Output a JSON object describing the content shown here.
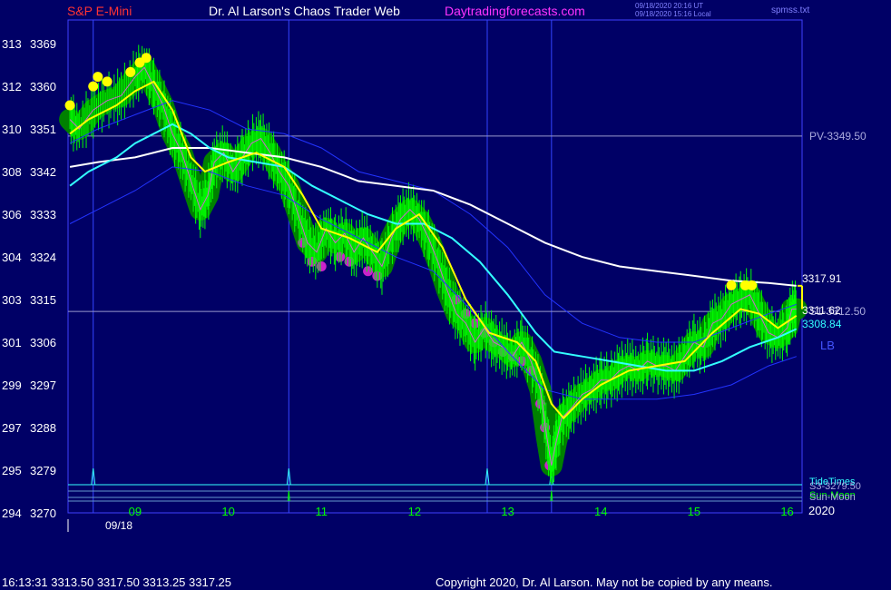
{
  "header": {
    "symbol": "S&P E-Mini",
    "site_title": "Dr. Al Larson's Chaos Trader Web",
    "site_link": "Daytradingforecasts.com",
    "stamp_utc": "09/18/2020 20:16 UT",
    "stamp_local": "09/18/2020 15:16 Local",
    "stamp_file": "spmss.txt"
  },
  "footer": {
    "last_bar": "16:13:31  3313.50 3317.50 3313.25 3317.25",
    "copyright": "Copyright 2020, Dr. Al Larson. May not be copied by any means."
  },
  "colors": {
    "background": "#000066",
    "frame": "#4040ff",
    "price": "#00ff00",
    "band": "#008000",
    "ema_fast": "#ffff00",
    "ema_mid": "#33ffff",
    "ema_slow": "#ffffff",
    "envelope": "#2233ff",
    "level_line": "#9999cc",
    "timing_line": "#3344ff",
    "tide_line": "#33ffff",
    "axis_text": "#ffffff",
    "hour_text": "#00ff00",
    "title_red": "#ff3333",
    "link_magenta": "#ff33ff"
  },
  "chart_data": {
    "type": "line",
    "title": "S&P E-Mini",
    "ylim": [
      3270,
      3374
    ],
    "xlim": [
      8.28,
      16.16
    ],
    "y_ticks": [
      {
        "sun": "313",
        "price": "3369"
      },
      {
        "sun": "312",
        "price": "3360"
      },
      {
        "sun": "310",
        "price": "3351"
      },
      {
        "sun": "308",
        "price": "3342"
      },
      {
        "sun": "306",
        "price": "3333"
      },
      {
        "sun": "304",
        "price": "3324"
      },
      {
        "sun": "303",
        "price": "3315"
      },
      {
        "sun": "301",
        "price": "3306"
      },
      {
        "sun": "299",
        "price": "3297"
      },
      {
        "sun": "297",
        "price": "3288"
      },
      {
        "sun": "295",
        "price": "3279"
      },
      {
        "sun": "294",
        "price": "3270"
      }
    ],
    "x_ticks": [
      "09",
      "10",
      "11",
      "12",
      "13",
      "14",
      "15",
      "16"
    ],
    "date_label": "09/18",
    "year_label": "2020",
    "levels": [
      {
        "label": "PV-3349.50",
        "value": 3349.5
      },
      {
        "label": "S1-3312.50",
        "value": 3312.5
      }
    ],
    "bottom_labels": [
      "TideTimes",
      "S3-3279.50",
      "Sun-Moon",
      "Sun-Moon"
    ],
    "last_values": [
      {
        "label": "3317.91",
        "value": 3317.91,
        "series": "ema_slow"
      },
      {
        "label": "3311.62",
        "value": 3311.62,
        "series": "ema_fast"
      },
      {
        "label": "3308.84",
        "value": 3308.84,
        "series": "ema_mid"
      }
    ],
    "side_labels": [
      "LB"
    ],
    "vertical_time_lines": [
      8.55,
      10.65,
      12.78,
      13.47
    ],
    "tide_spikes": [
      8.55,
      10.65,
      12.78,
      13.47
    ],
    "moon_spikes": [
      10.65,
      13.47
    ],
    "series": [
      {
        "name": "price",
        "points": [
          [
            8.3,
            3353
          ],
          [
            8.4,
            3351
          ],
          [
            8.55,
            3355
          ],
          [
            8.7,
            3357
          ],
          [
            8.85,
            3358
          ],
          [
            9.0,
            3362
          ],
          [
            9.1,
            3364
          ],
          [
            9.2,
            3360
          ],
          [
            9.3,
            3356
          ],
          [
            9.4,
            3350
          ],
          [
            9.5,
            3346
          ],
          [
            9.6,
            3340
          ],
          [
            9.7,
            3334
          ],
          [
            9.78,
            3337
          ],
          [
            9.85,
            3344
          ],
          [
            9.95,
            3346
          ],
          [
            10.05,
            3342
          ],
          [
            10.15,
            3345
          ],
          [
            10.25,
            3348
          ],
          [
            10.35,
            3349
          ],
          [
            10.45,
            3346
          ],
          [
            10.55,
            3342
          ],
          [
            10.65,
            3339
          ],
          [
            10.75,
            3333
          ],
          [
            10.85,
            3327
          ],
          [
            10.95,
            3325
          ],
          [
            11.05,
            3330
          ],
          [
            11.15,
            3327
          ],
          [
            11.25,
            3329
          ],
          [
            11.35,
            3325
          ],
          [
            11.45,
            3328
          ],
          [
            11.55,
            3325
          ],
          [
            11.65,
            3322
          ],
          [
            11.75,
            3328
          ],
          [
            11.85,
            3332
          ],
          [
            11.95,
            3334
          ],
          [
            12.05,
            3332
          ],
          [
            12.15,
            3328
          ],
          [
            12.25,
            3323
          ],
          [
            12.35,
            3317
          ],
          [
            12.45,
            3312
          ],
          [
            12.55,
            3310
          ],
          [
            12.65,
            3306
          ],
          [
            12.75,
            3309
          ],
          [
            12.85,
            3306
          ],
          [
            12.95,
            3305
          ],
          [
            13.05,
            3303
          ],
          [
            13.15,
            3306
          ],
          [
            13.25,
            3302
          ],
          [
            13.35,
            3296
          ],
          [
            13.42,
            3286
          ],
          [
            13.47,
            3280
          ],
          [
            13.52,
            3285
          ],
          [
            13.58,
            3290
          ],
          [
            13.68,
            3292
          ],
          [
            13.8,
            3295
          ],
          [
            13.9,
            3296
          ],
          [
            14.0,
            3298
          ],
          [
            14.1,
            3298
          ],
          [
            14.2,
            3300
          ],
          [
            14.3,
            3301
          ],
          [
            14.4,
            3300
          ],
          [
            14.5,
            3302
          ],
          [
            14.6,
            3301
          ],
          [
            14.7,
            3301
          ],
          [
            14.8,
            3300
          ],
          [
            14.9,
            3303
          ],
          [
            15.0,
            3306
          ],
          [
            15.1,
            3305
          ],
          [
            15.2,
            3310
          ],
          [
            15.3,
            3311
          ],
          [
            15.4,
            3314
          ],
          [
            15.5,
            3315
          ],
          [
            15.6,
            3316
          ],
          [
            15.7,
            3312
          ],
          [
            15.8,
            3308
          ],
          [
            15.9,
            3307
          ],
          [
            16.0,
            3309
          ],
          [
            16.05,
            3313
          ],
          [
            16.1,
            3313
          ]
        ]
      },
      {
        "name": "ema_fast",
        "points": [
          [
            8.3,
            3350
          ],
          [
            8.5,
            3353
          ],
          [
            8.8,
            3356
          ],
          [
            9.0,
            3359
          ],
          [
            9.2,
            3361
          ],
          [
            9.4,
            3355
          ],
          [
            9.6,
            3345
          ],
          [
            9.75,
            3342
          ],
          [
            10.0,
            3344
          ],
          [
            10.3,
            3346
          ],
          [
            10.6,
            3343
          ],
          [
            10.8,
            3337
          ],
          [
            11.0,
            3330
          ],
          [
            11.3,
            3328
          ],
          [
            11.6,
            3325
          ],
          [
            11.8,
            3330
          ],
          [
            12.05,
            3333
          ],
          [
            12.3,
            3326
          ],
          [
            12.55,
            3315
          ],
          [
            12.8,
            3308
          ],
          [
            13.1,
            3306
          ],
          [
            13.3,
            3302
          ],
          [
            13.47,
            3293
          ],
          [
            13.6,
            3290
          ],
          [
            13.8,
            3294
          ],
          [
            14.0,
            3297
          ],
          [
            14.3,
            3300
          ],
          [
            14.6,
            3301
          ],
          [
            14.9,
            3302
          ],
          [
            15.2,
            3308
          ],
          [
            15.5,
            3313
          ],
          [
            15.7,
            3312
          ],
          [
            15.9,
            3309
          ],
          [
            16.1,
            3311.6
          ]
        ]
      },
      {
        "name": "ema_mid",
        "points": [
          [
            8.3,
            3339
          ],
          [
            8.5,
            3342
          ],
          [
            8.8,
            3345
          ],
          [
            9.0,
            3348
          ],
          [
            9.2,
            3350
          ],
          [
            9.4,
            3352
          ],
          [
            9.6,
            3350
          ],
          [
            9.8,
            3347
          ],
          [
            10.0,
            3345
          ],
          [
            10.3,
            3344
          ],
          [
            10.6,
            3343
          ],
          [
            10.9,
            3339
          ],
          [
            11.2,
            3336
          ],
          [
            11.5,
            3333
          ],
          [
            11.8,
            3331
          ],
          [
            12.1,
            3331
          ],
          [
            12.4,
            3328
          ],
          [
            12.7,
            3323
          ],
          [
            13.0,
            3316
          ],
          [
            13.3,
            3308
          ],
          [
            13.5,
            3304
          ],
          [
            13.8,
            3303
          ],
          [
            14.1,
            3302
          ],
          [
            14.4,
            3301
          ],
          [
            14.7,
            3300
          ],
          [
            15.0,
            3300
          ],
          [
            15.3,
            3302
          ],
          [
            15.6,
            3305
          ],
          [
            15.9,
            3307
          ],
          [
            16.1,
            3308.8
          ]
        ]
      },
      {
        "name": "ema_slow",
        "points": [
          [
            8.3,
            3343
          ],
          [
            8.6,
            3344
          ],
          [
            9.0,
            3345
          ],
          [
            9.4,
            3347
          ],
          [
            9.8,
            3347
          ],
          [
            10.2,
            3346
          ],
          [
            10.6,
            3345
          ],
          [
            11.0,
            3343
          ],
          [
            11.4,
            3340
          ],
          [
            11.8,
            3339
          ],
          [
            12.2,
            3338
          ],
          [
            12.6,
            3335
          ],
          [
            13.0,
            3331
          ],
          [
            13.4,
            3327
          ],
          [
            13.8,
            3324
          ],
          [
            14.2,
            3322
          ],
          [
            14.6,
            3321
          ],
          [
            15.0,
            3320
          ],
          [
            15.4,
            3319
          ],
          [
            15.8,
            3318.5
          ],
          [
            16.1,
            3317.9
          ]
        ]
      },
      {
        "name": "envelope_upper",
        "points": [
          [
            8.3,
            3348
          ],
          [
            8.6,
            3351
          ],
          [
            9.0,
            3354
          ],
          [
            9.4,
            3357
          ],
          [
            9.8,
            3355
          ],
          [
            10.2,
            3351
          ],
          [
            10.6,
            3350
          ],
          [
            11.0,
            3347
          ],
          [
            11.4,
            3342
          ],
          [
            11.8,
            3340
          ],
          [
            12.2,
            3338
          ],
          [
            12.6,
            3333
          ],
          [
            13.0,
            3326
          ],
          [
            13.4,
            3316
          ],
          [
            13.8,
            3310
          ],
          [
            14.2,
            3307
          ],
          [
            14.6,
            3306
          ],
          [
            15.0,
            3306
          ],
          [
            15.4,
            3309
          ],
          [
            15.8,
            3312
          ],
          [
            16.1,
            3314
          ]
        ]
      },
      {
        "name": "envelope_lower",
        "points": [
          [
            8.3,
            3331
          ],
          [
            8.6,
            3334
          ],
          [
            9.0,
            3338
          ],
          [
            9.4,
            3343
          ],
          [
            9.8,
            3342
          ],
          [
            10.2,
            3339
          ],
          [
            10.6,
            3337
          ],
          [
            11.0,
            3332
          ],
          [
            11.4,
            3328
          ],
          [
            11.8,
            3324
          ],
          [
            12.2,
            3321
          ],
          [
            12.6,
            3313
          ],
          [
            13.0,
            3304
          ],
          [
            13.4,
            3296
          ],
          [
            13.8,
            3294
          ],
          [
            14.2,
            3294
          ],
          [
            14.6,
            3294
          ],
          [
            15.0,
            3295
          ],
          [
            15.4,
            3297
          ],
          [
            15.8,
            3301
          ],
          [
            16.1,
            3303
          ]
        ]
      }
    ],
    "highlights": [
      {
        "color": "yellow",
        "points": [
          [
            8.3,
            3356
          ],
          [
            8.55,
            3360
          ],
          [
            8.6,
            3362
          ],
          [
            8.7,
            3361
          ],
          [
            8.95,
            3363
          ],
          [
            9.05,
            3365
          ],
          [
            9.12,
            3366
          ],
          [
            15.4,
            3318
          ],
          [
            15.55,
            3318
          ],
          [
            15.62,
            3318
          ]
        ]
      },
      {
        "color": "magenta",
        "points": [
          [
            10.8,
            3327
          ],
          [
            10.9,
            3323
          ],
          [
            11.0,
            3322
          ],
          [
            11.2,
            3324
          ],
          [
            11.3,
            3323
          ],
          [
            11.5,
            3321
          ],
          [
            11.6,
            3320
          ],
          [
            12.45,
            3315
          ],
          [
            12.55,
            3312
          ],
          [
            12.65,
            3310
          ],
          [
            12.75,
            3308
          ],
          [
            12.85,
            3306
          ],
          [
            12.95,
            3304
          ],
          [
            13.05,
            3303
          ],
          [
            13.15,
            3302
          ],
          [
            13.25,
            3300
          ],
          [
            13.35,
            3293
          ],
          [
            13.4,
            3288
          ],
          [
            13.45,
            3280
          ]
        ]
      }
    ]
  }
}
